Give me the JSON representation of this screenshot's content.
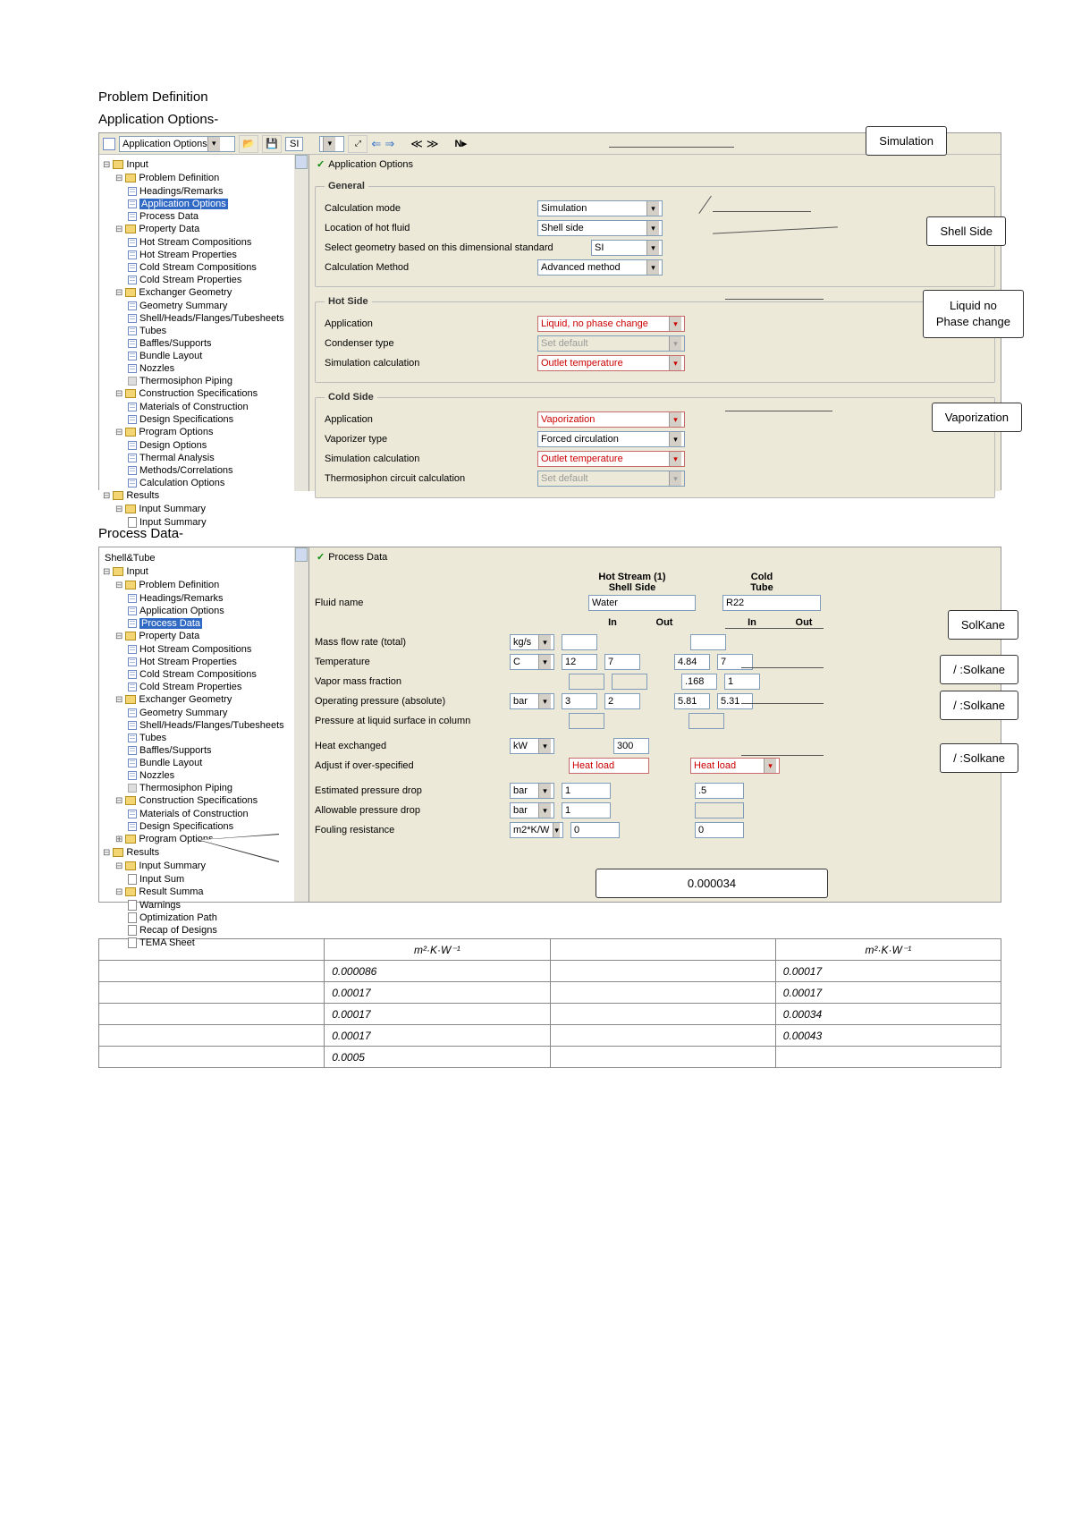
{
  "headings": {
    "h1": "Problem Definition",
    "h2a": "Application Options-",
    "h2b": "Process Data-"
  },
  "callouts": {
    "simulation": "Simulation",
    "shell_side": "Shell Side",
    "liquid_no": "Liquid    no",
    "phase_change": "Phase   change",
    "vaporization": "Vaporization",
    "solkane1": "SolKane",
    "solkane_row": ":Solkane",
    "fouling_val": "0.000034"
  },
  "toolbar1": {
    "combo_label": "Application Options",
    "si": "SI",
    "np": "N▸"
  },
  "toolbar2": {
    "app_label": "Shell&Tube"
  },
  "tree1": {
    "t1": "Input",
    "t2": "Problem Definition",
    "t2a": "Headings/Remarks",
    "t2b": "Application Options",
    "t2c": "Process Data",
    "t3": "Property Data",
    "t3a": "Hot Stream Compositions",
    "t3b": "Hot Stream Properties",
    "t3c": "Cold Stream Compositions",
    "t3d": "Cold Stream Properties",
    "t4": "Exchanger Geometry",
    "t4a": "Geometry Summary",
    "t4b": "Shell/Heads/Flanges/Tubesheets",
    "t4c": "Tubes",
    "t4d": "Baffles/Supports",
    "t4e": "Bundle Layout",
    "t4f": "Nozzles",
    "t4g": "Thermosiphon Piping",
    "t5": "Construction Specifications",
    "t5a": "Materials of Construction",
    "t5b": "Design Specifications",
    "t6": "Program Options",
    "t6a": "Design Options",
    "t6b": "Thermal Analysis",
    "t6c": "Methods/Correlations",
    "t6d": "Calculation Options",
    "t7": "Results",
    "t8": "Input Summary",
    "t8a": "Input Summary"
  },
  "form1": {
    "title": "Application Options",
    "g1": "General",
    "g1_r1": "Calculation mode",
    "g1_r1_v": "Simulation",
    "g1_r2": "Location of hot fluid",
    "g1_r2_v": "Shell side",
    "g1_r3": "Select geometry based on this dimensional standard",
    "g1_r3_v": "SI",
    "g1_r4": "Calculation Method",
    "g1_r4_v": "Advanced method",
    "hs": "Hot Side",
    "hs_r1": "Application",
    "hs_r1_v": "Liquid, no phase change",
    "hs_r2": "Condenser type",
    "hs_r2_v": "Set default",
    "hs_r3": "Simulation calculation",
    "hs_r3_v": "Outlet temperature",
    "cs": "Cold Side",
    "cs_r1": "Application",
    "cs_r1_v": "Vaporization",
    "cs_r2": "Vaporizer type",
    "cs_r2_v": "Forced circulation",
    "cs_r3": "Simulation calculation",
    "cs_r3_v": "Outlet temperature",
    "cs_r4": "Thermosiphon circuit calculation",
    "cs_r4_v": "Set default"
  },
  "tree2": {
    "extra1": "Result Summa",
    "extra2": "Warnings",
    "extra3": "Optimization Path",
    "extra4": "Recap of Designs",
    "extra5": "TEMA Sheet",
    "inputsum": "Input Sum"
  },
  "form2": {
    "title": "Process Data",
    "h_hot": "Hot Stream (1)",
    "h_hot2": "Shell Side",
    "h_cold": "Cold",
    "h_tube": "Tube",
    "in": "In",
    "out": "Out",
    "r_fluid": "Fluid name",
    "r_fluid_hot": "Water",
    "r_fluid_cold": "R22",
    "r_mass": "Mass flow rate (total)",
    "u_mass": "kg/s",
    "r_temp": "Temperature",
    "u_temp": "C",
    "v_temp_hin": "12",
    "v_temp_hout": "7",
    "v_temp_cin": "4.84",
    "v_temp_cout": "7",
    "r_vap": "Vapor mass fraction",
    "v_vap_cin": ".168",
    "v_vap_cout": "1",
    "r_press": "Operating pressure (absolute)",
    "u_press": "bar",
    "v_press_hin": "3",
    "v_press_hout": "2",
    "v_press_cin": "5.81",
    "v_press_cout": "5.31",
    "r_pressliq": "Pressure at liquid surface in column",
    "r_heat": "Heat exchanged",
    "u_heat": "kW",
    "v_heat": "300",
    "r_adj": "Adjust if over-specified",
    "v_adj_hot": "Heat load",
    "v_adj_cold": "Heat load",
    "r_estpd": "Estimated pressure drop",
    "u_bar": "bar",
    "v_estpd_h": "1",
    "v_estpd_c": ".5",
    "r_allpd": "Allowable pressure drop",
    "v_allpd_h": "1",
    "r_foul": "Fouling resistance",
    "u_foul": "m2*K/W",
    "v_foul_h": "0",
    "v_foul_c": "0"
  },
  "bottom_table": {
    "unit": "m²·K·W⁻¹",
    "rows": [
      [
        "0.000086",
        "",
        "0.00017"
      ],
      [
        "0.00017",
        "",
        "0.00017"
      ],
      [
        "0.00017",
        "",
        "0.00034"
      ],
      [
        "0.00017",
        "",
        "0.00043"
      ],
      [
        "0.0005",
        "",
        ""
      ]
    ]
  }
}
